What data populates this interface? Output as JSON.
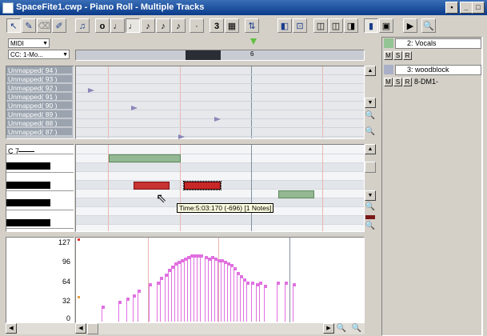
{
  "window": {
    "title": "SpaceFite1.cwp - Piano Roll - Multiple Tracks",
    "min": "_",
    "max": "□",
    "close": "×",
    "lock": "🔒"
  },
  "toolbar": {
    "tools": [
      "select-tool",
      "draw-tool",
      "erase-tool",
      "scrub-tool"
    ],
    "snap_label": "3",
    "durations": [
      "o",
      "♩",
      "♩",
      "♪",
      "♪",
      "♪",
      "·"
    ]
  },
  "controller": {
    "dropdown1": "MIDI",
    "dropdown2": "CC: 1-Mo..."
  },
  "ruler": {
    "marker": "6"
  },
  "drum_lanes": [
    "Unmapped( 94 )",
    "Unmapped( 93 )",
    "Unmapped( 92 )",
    "Unmapped( 91 )",
    "Unmapped( 90 )",
    "Unmapped( 89 )",
    "Unmapped( 88 )",
    "Unmapped( 87 )"
  ],
  "keyboard": {
    "c_label": "C 7"
  },
  "tooltip": "Time:5:03:170 (-696) [1 Notes]",
  "velocity_axis": [
    "127",
    "96",
    "64",
    "32",
    "0"
  ],
  "tracks": [
    {
      "name": "2: Vocals",
      "m": "M",
      "s": "S",
      "r": "R",
      "extra": ""
    },
    {
      "name": "3: woodblock",
      "m": "M",
      "s": "S",
      "r": "R",
      "extra": "8-DM1-"
    }
  ],
  "colors": {
    "note_green": "#93b893",
    "note_red": "#c83232",
    "velocity": "#e070e0",
    "grid_bg": "#e6e8ec"
  }
}
